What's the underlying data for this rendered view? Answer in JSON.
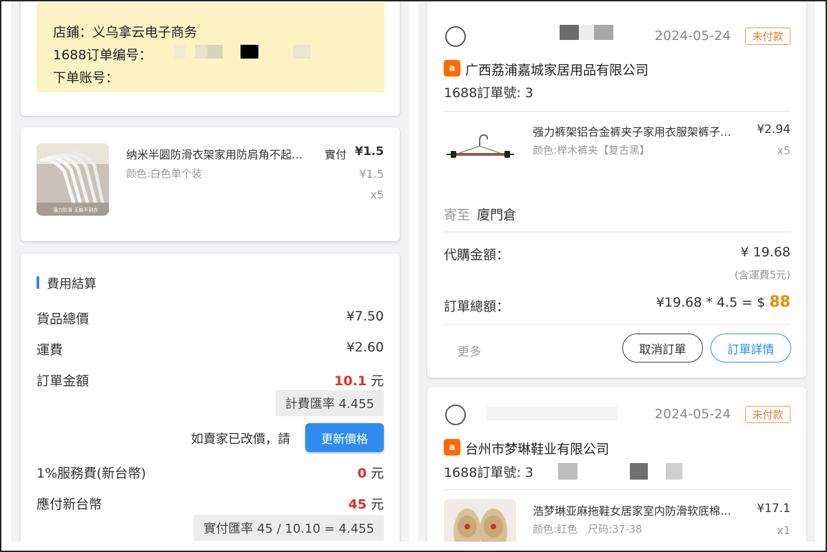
{
  "left": {
    "store_info": {
      "store_label": "店鋪：义乌拿云电子商务",
      "order_no_label": "1688订单编号：",
      "account_label": "下单账号："
    },
    "product": {
      "title": "纳米半圆防滑衣架家用防肩角不起…",
      "paid_label": "實付",
      "paid_price": "¥1.5",
      "variant": "颜色:白色单个装",
      "original_price": "¥1.5",
      "qty": "x5",
      "thumb_caption": "强力防滑 无痕不割衣"
    },
    "fees": {
      "title": "費用結算",
      "goods_total_label": "貨品總價",
      "goods_total": "¥7.50",
      "shipping_label": "運費",
      "shipping": "¥2.60",
      "order_amount_label": "訂單金額",
      "order_amount": "10.1",
      "unit_yuan": "元",
      "billing_rate": "計費匯率 4.455",
      "price_change_note": "如賣家已改價，請",
      "update_button": "更新價格",
      "service_fee_label": "1%服務費(新台幣)",
      "service_fee": "0",
      "payable_label": "應付新台幣",
      "payable": "45",
      "actual_rate": "實付匯率 45 / 10.10 = 4.455"
    }
  },
  "right": {
    "order1": {
      "date": "2024-05-24",
      "status": "未付款",
      "logo_text": "a",
      "company": "广西荔浦嘉城家居用品有限公司",
      "order_no_label": "1688訂單號: 3",
      "item_title": "强力裤架铝合金裤夹子家用衣服架裤子…",
      "item_price": "¥2.94",
      "item_variant": "颜色:榉木裤夹【复古黑】",
      "item_qty": "x5",
      "ship_to_label": "寄至",
      "ship_to": "廈門倉",
      "agent_amount_label": "代購金額：",
      "agent_amount": "¥ 19.68",
      "shipping_note": "(含運費5元)",
      "total_label": "訂單總額：",
      "total_formula": "¥19.68 * 4.5 = $",
      "total_value": "88",
      "more": "更多",
      "cancel_button": "取消訂單",
      "detail_button": "訂單詳情"
    },
    "order2": {
      "date": "2024-05-24",
      "status": "未付款",
      "logo_text": "a",
      "company": "台州市梦琳鞋业有限公司",
      "order_no_label": "1688訂單號: 3",
      "item_title": "浩梦琳亚麻拖鞋女居家室内防滑软底棉…",
      "item_price": "¥17.1",
      "item_variant": "颜色:红色　尺码:37-38",
      "item_qty": "x1"
    }
  },
  "colors": {
    "accent_blue": "#2f8cee",
    "price_red": "#d9302a",
    "status_orange": "#e0782a",
    "total_orange": "#f08c00",
    "notice_yellow": "#fbf3c4"
  }
}
